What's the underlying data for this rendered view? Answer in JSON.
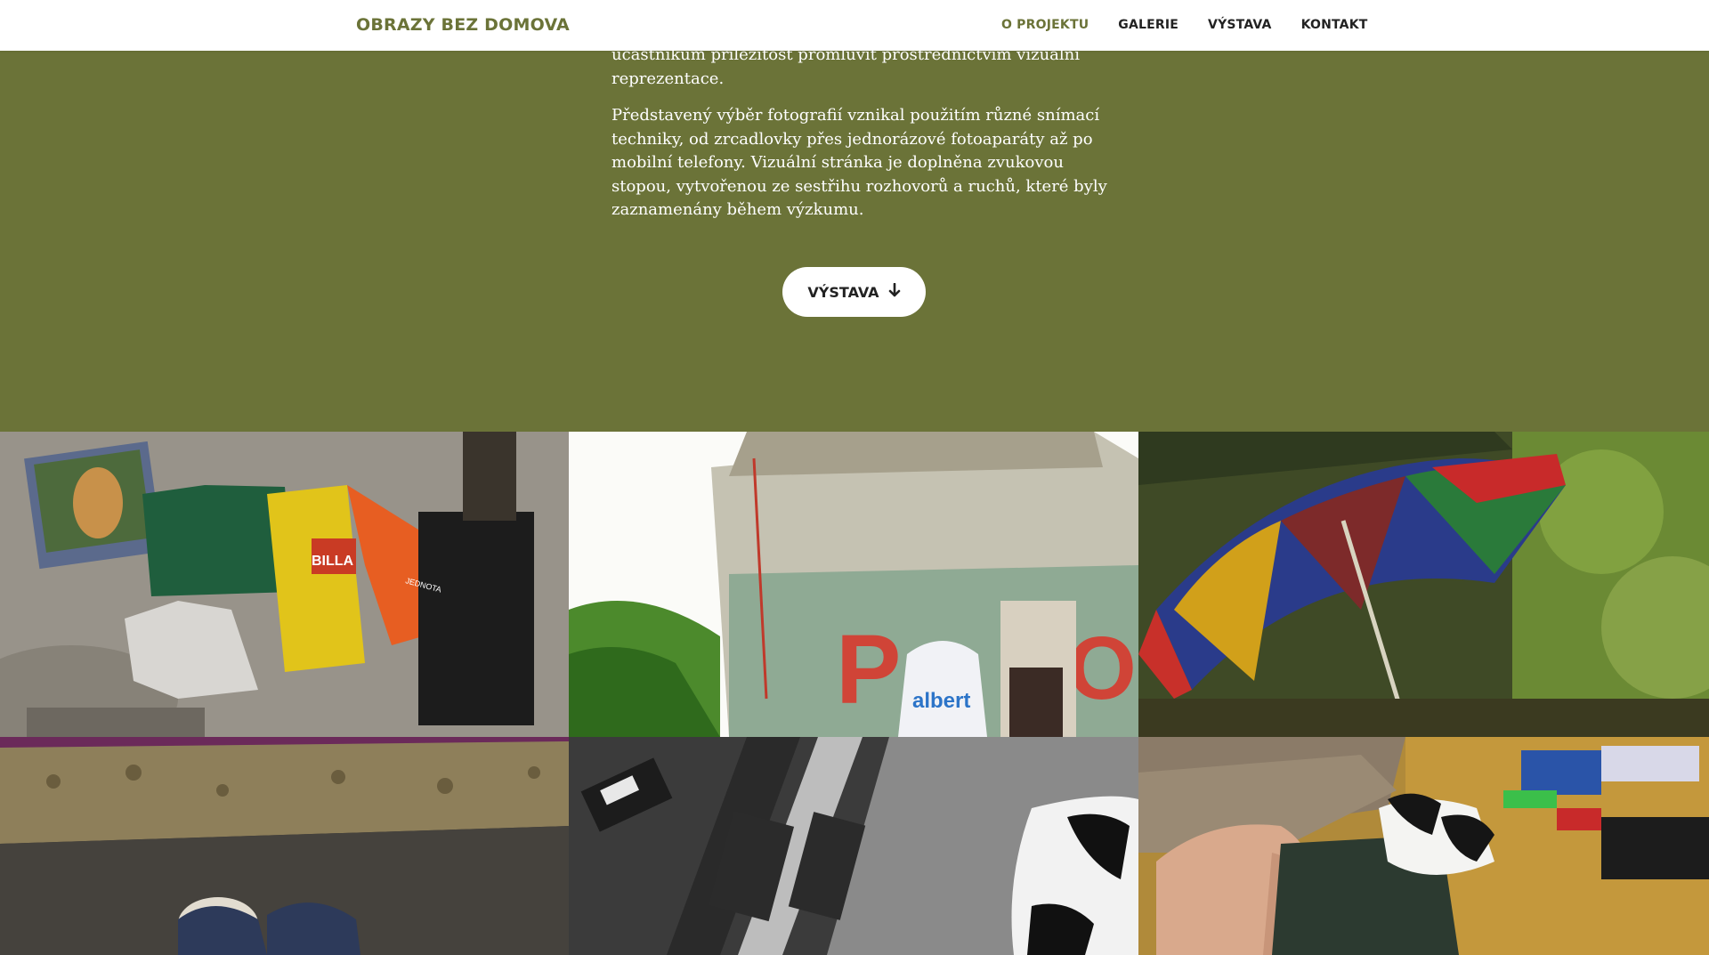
{
  "navbar": {
    "brand": "OBRAZY BEZ DOMOVA",
    "items": [
      {
        "label": "O PROJEKTU",
        "active": true
      },
      {
        "label": "GALERIE",
        "active": false
      },
      {
        "label": "VÝSTAVA",
        "active": false
      },
      {
        "label": "KONTAKT",
        "active": false
      }
    ]
  },
  "hero": {
    "paragraphs": [
      "účastníkům příležitost promluvit prostřednictvím vizuální reprezentace.",
      "Představený výběr fotografií vznikal použitím různé snímací techniky, od zrcadlovky přes jednorázové fotoaparáty až po mobilní telefony. Vizuální stránka je doplněna zvukovou stopou, vytvořenou ze sestřihu rozhovorů a ruchů, které byly zaznamenány během výzkumu."
    ],
    "button_label": "VÝSTAVA",
    "button_icon": "arrow-down-icon"
  },
  "gallery": {
    "photos": [
      {
        "name": "photo-bags-wall",
        "text": "BILLA",
        "text2": "JEDNOTA"
      },
      {
        "name": "photo-pillar-graffiti",
        "text": "albert"
      },
      {
        "name": "photo-umbrella-camp",
        "text": ""
      },
      {
        "name": "photo-shoes-floor",
        "text": ""
      },
      {
        "name": "photo-cat-rails-bw",
        "text": ""
      },
      {
        "name": "photo-hand-kitten",
        "text": ""
      }
    ]
  },
  "colors": {
    "accent": "#6b7338",
    "nav_text": "#222222",
    "hero_text": "#ffffff"
  }
}
